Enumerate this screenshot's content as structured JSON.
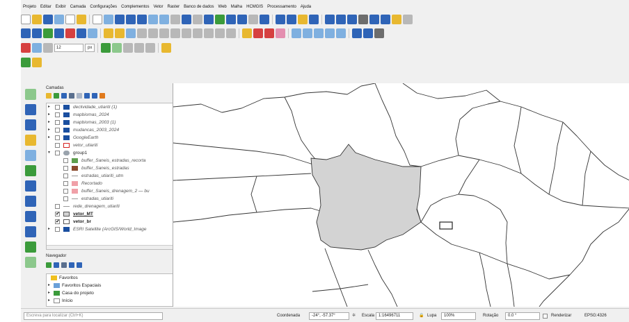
{
  "menu": [
    "Projeto",
    "Editar",
    "Exibir",
    "Camada",
    "Configurações",
    "Complementos",
    "Vetor",
    "Raster",
    "Banco de dados",
    "Web",
    "Malha",
    "HCMGIS",
    "Processamento",
    "Ajuda"
  ],
  "toolbar3": {
    "size_value": "12",
    "unit_value": "px"
  },
  "layers_panel": {
    "title": "Camadas",
    "items": [
      {
        "label": "declividade_utiariti (1)"
      },
      {
        "label": "mapbiomas_2024"
      },
      {
        "label": "mapbiomas_2003 (1)"
      },
      {
        "label": "mudancas_2003_2024"
      },
      {
        "label": "GoogleEarth"
      },
      {
        "label": "vetor_utiariti"
      },
      {
        "label": "group1"
      },
      {
        "label": "buffer_Saneis_estradas_recorta"
      },
      {
        "label": "buffer_Saneis_estradas"
      },
      {
        "label": "estradas_utiariti_utm"
      },
      {
        "label": "Recortado"
      },
      {
        "label": "buffer_Saneis_drenagem_2 — bu"
      },
      {
        "label": "estradas_utiariti"
      },
      {
        "label": "rede_drenagem_utiariti"
      },
      {
        "label": "vetor_MT"
      },
      {
        "label": "vetor_br"
      },
      {
        "label": "ESRI Satellite (ArcGIS/World_Image"
      }
    ]
  },
  "browser_panel": {
    "title": "Navegador",
    "items": [
      {
        "label": "Favoritos"
      },
      {
        "label": "Favoritos Espaciais"
      },
      {
        "label": "Casa do projeto"
      },
      {
        "label": "Início"
      }
    ]
  },
  "status": {
    "search_placeholder": "Escreva para localizar (Ctrl+K)",
    "coord_label": "Coordenada",
    "coord_value": "-24°, -57.37°",
    "scale_label": "Escala",
    "scale_value": "1:16496711",
    "magnifier_label": "Lupa",
    "magnifier_value": "100%",
    "rotation_label": "Rotação",
    "rotation_value": "0.0 °",
    "render_label": "Renderizar",
    "crs_label": "EPSG:4326"
  },
  "colors": {
    "selected_state_fill": "#d3d3d3",
    "panel_bg": "#f0f0f0",
    "swatch_green": "#5e9e4d",
    "swatch_brown": "#8b4a2e",
    "swatch_pink": "#f0a0a8",
    "outline_red": "#d42020"
  }
}
